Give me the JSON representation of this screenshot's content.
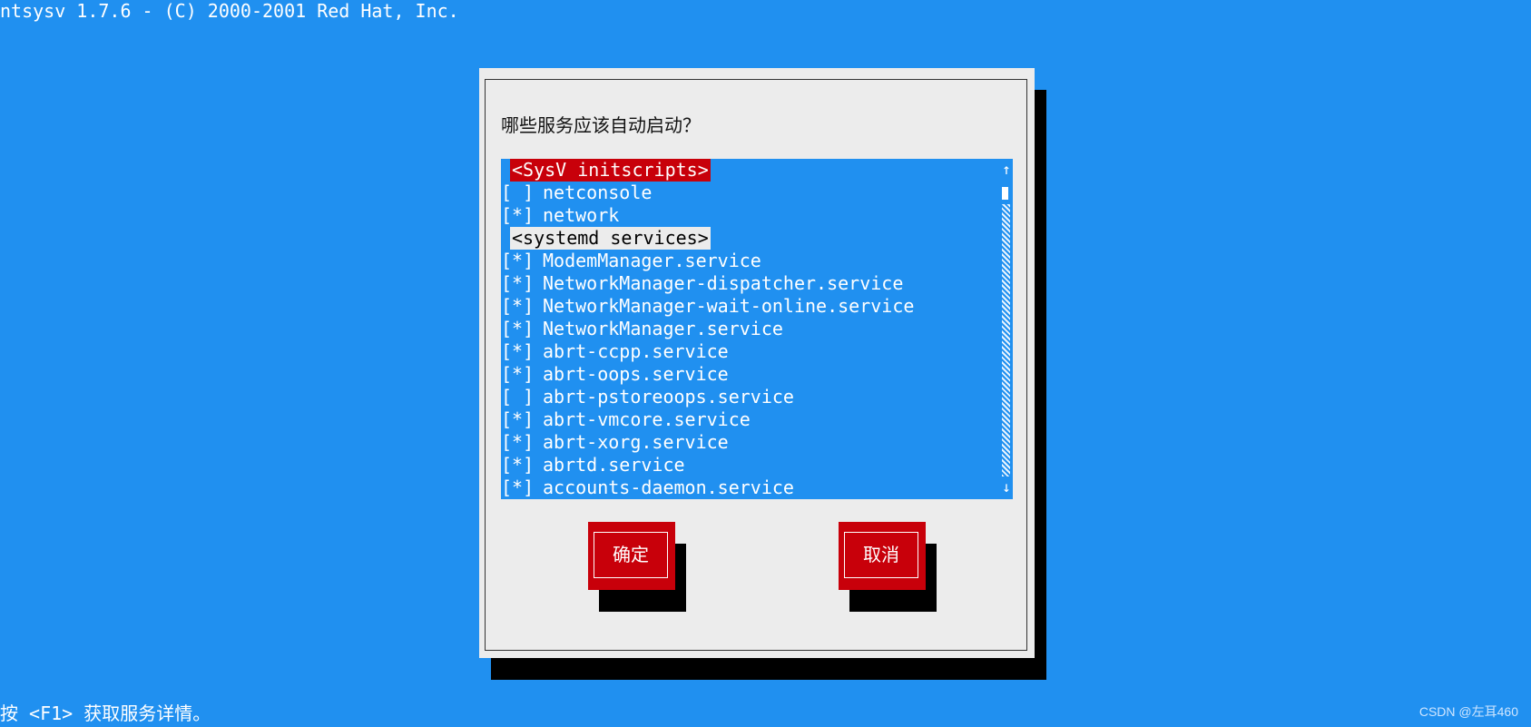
{
  "app": {
    "title": "ntsysv 1.7.6 - (C) 2000-2001 Red Hat, Inc."
  },
  "dialog": {
    "prompt": "哪些服务应该自动启动？",
    "buttons": {
      "ok": "确定",
      "cancel": "取消"
    }
  },
  "list": {
    "rows": [
      {
        "type": "header",
        "label": "<SysV initscripts>",
        "highlight": true
      },
      {
        "type": "item",
        "check": "[ ]",
        "label": "netconsole"
      },
      {
        "type": "item",
        "check": "[*]",
        "label": "network"
      },
      {
        "type": "header",
        "label": "<systemd services>",
        "highlight": false
      },
      {
        "type": "item",
        "check": "[*]",
        "label": "ModemManager.service"
      },
      {
        "type": "item",
        "check": "[*]",
        "label": "NetworkManager-dispatcher.service"
      },
      {
        "type": "item",
        "check": "[*]",
        "label": "NetworkManager-wait-online.service"
      },
      {
        "type": "item",
        "check": "[*]",
        "label": "NetworkManager.service"
      },
      {
        "type": "item",
        "check": "[*]",
        "label": "abrt-ccpp.service"
      },
      {
        "type": "item",
        "check": "[*]",
        "label": "abrt-oops.service"
      },
      {
        "type": "item",
        "check": "[ ]",
        "label": "abrt-pstoreoops.service"
      },
      {
        "type": "item",
        "check": "[*]",
        "label": "abrt-vmcore.service"
      },
      {
        "type": "item",
        "check": "[*]",
        "label": "abrt-xorg.service"
      },
      {
        "type": "item",
        "check": "[*]",
        "label": "abrtd.service"
      },
      {
        "type": "item",
        "check": "[*]",
        "label": "accounts-daemon.service"
      }
    ],
    "scroll": {
      "up_glyph": "↑",
      "down_glyph": "↓"
    }
  },
  "footer": {
    "help": "按 <F1> 获取服务详情。",
    "watermark": "CSDN @左耳460"
  },
  "colors": {
    "background": "#2090f0",
    "dialog": "#ececec",
    "accent_red": "#c8000a",
    "text_white": "#ffffff",
    "shadow": "#000000"
  }
}
